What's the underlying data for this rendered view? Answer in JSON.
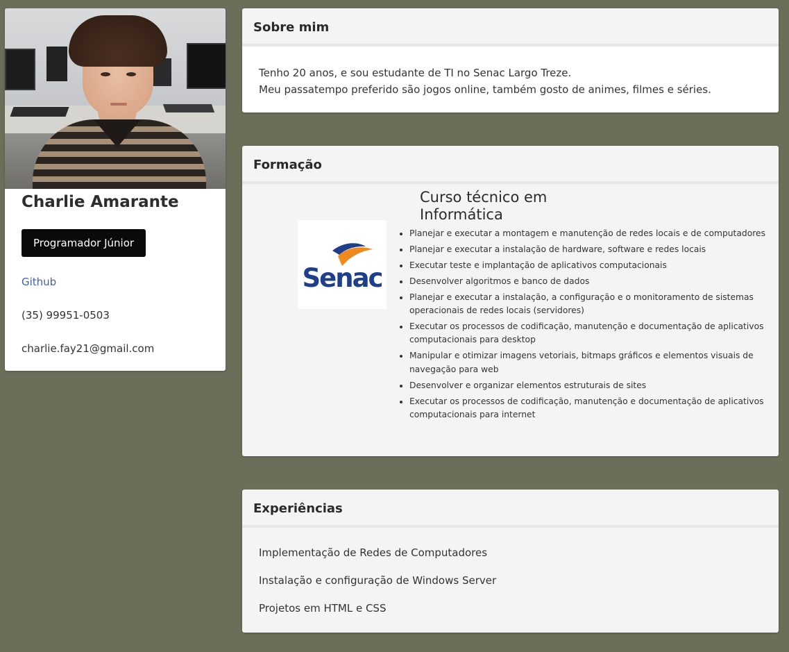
{
  "profile": {
    "name": "Charlie Amarante",
    "role_button": "Programador Júnior",
    "github_link": "Github",
    "phone": "(35) 99951-0503",
    "email": "charlie.fay21@gmail.com"
  },
  "about": {
    "title": "Sobre mim",
    "lines": [
      "Tenho 20 anos, e sou estudante de TI no Senac Largo Treze.",
      "Meu passatempo preferido são jogos online, também gosto de animes, filmes e séries."
    ]
  },
  "education": {
    "title": "Formação",
    "logo_text": "Senac",
    "course_title": "Curso técnico em Informática",
    "items": [
      "Planejar e executar a montagem e manutenção de redes locais e de computadores",
      "Planejar e executar a instalação de hardware, software e redes locais",
      "Executar teste e implantação de aplicativos computacionais",
      "Desenvolver algoritmos e banco de dados",
      "Planejar e executar a instalação, a configuração e o monitoramento de sistemas operacionais de redes locais (servidores)",
      "Executar os processos de codificação, manutenção e documentação de aplicativos computacionais para desktop",
      "Manipular e otimizar imagens vetoriais, bitmaps gráficos e elementos visuais de navegação para web",
      "Desenvolver e organizar elementos estruturais de sites",
      "Executar os processos de codificação, manutenção e documentação de aplicativos computacionais para internet"
    ]
  },
  "experience": {
    "title": "Experiências",
    "items": [
      "Implementação de Redes de Computadores",
      "Instalação e configuração de Windows Server",
      "Projetos em HTML e CSS"
    ]
  },
  "colors": {
    "background": "#6b6f5a",
    "logo_blue": "#1f3f8a",
    "logo_orange": "#f08a1c"
  }
}
